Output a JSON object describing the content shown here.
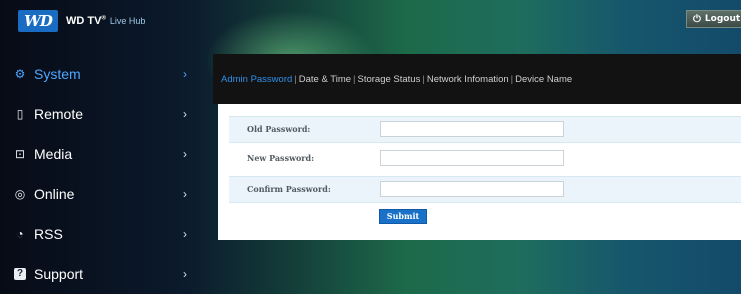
{
  "header": {
    "logo_text": "WD",
    "product": "WD TV",
    "trademark": "®",
    "subtitle": "Live Hub",
    "logout_label": "Logout",
    "logout_icon": "power-icon"
  },
  "sidebar": {
    "items": [
      {
        "label": "System",
        "icon": "gear-icon",
        "glyph": "⚙",
        "active": true
      },
      {
        "label": "Remote",
        "icon": "remote-icon",
        "glyph": "▯",
        "active": false
      },
      {
        "label": "Media",
        "icon": "media-icon",
        "glyph": "⊡",
        "active": false
      },
      {
        "label": "Online",
        "icon": "online-icon",
        "glyph": "◎",
        "active": false
      },
      {
        "label": "RSS",
        "icon": "rss-icon",
        "glyph": "◔",
        "active": false
      },
      {
        "label": "Support",
        "icon": "help-icon",
        "glyph": "?",
        "active": false
      }
    ],
    "chevron": "›"
  },
  "tabs": [
    {
      "label": "Admin Password",
      "active": true
    },
    {
      "label": "Date & Time",
      "active": false
    },
    {
      "label": "Storage Status",
      "active": false
    },
    {
      "label": "Network Infomation",
      "active": false
    },
    {
      "label": "Device Name",
      "active": false
    }
  ],
  "form": {
    "old_password_label": "Old Password:",
    "new_password_label": "New Password:",
    "confirm_password_label": "Confirm Password:",
    "old_password_value": "",
    "new_password_value": "",
    "confirm_password_value": "",
    "submit_label": "Submit"
  },
  "colors": {
    "accent": "#2f8fe8",
    "submit": "#1a72c8",
    "row_shade": "#eaf4fa"
  }
}
